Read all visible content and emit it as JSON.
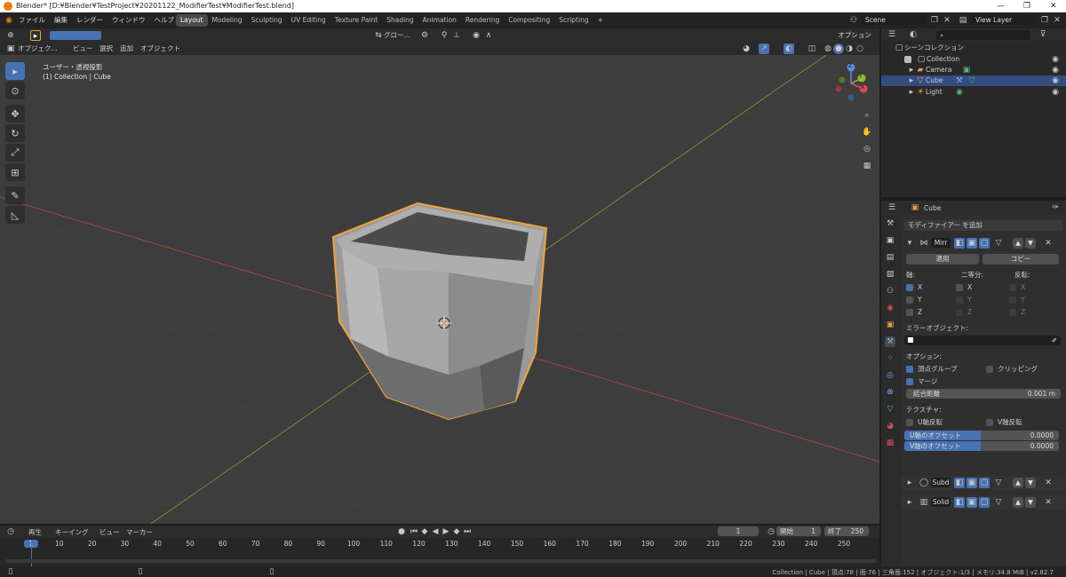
{
  "titlebar": {
    "title": "Blender* [D:¥Blender¥TestProject¥20201122_ModifierTest¥ModifierTest.blend]",
    "min": "—",
    "max": "❐",
    "close": "✕"
  },
  "menu": [
    "ファイル",
    "編集",
    "レンダー",
    "ウィンドウ",
    "ヘルプ"
  ],
  "workspaces": [
    "Layout",
    "Modeling",
    "Sculpting",
    "UV Editing",
    "Texture Paint",
    "Shading",
    "Animation",
    "Rendering",
    "Compositing",
    "Scripting",
    "+"
  ],
  "scene": {
    "label": "Scene",
    "view_layer": "View Layer"
  },
  "viewport": {
    "mode": "オブジェク...",
    "view": "ビュー",
    "select": "選択",
    "add": "追加",
    "object": "オブジェクト",
    "orientation": "グロー...",
    "options": "オプション",
    "info1": "ユーザー・透視投影",
    "info2": "(1) Collection | Cube",
    "axes": {
      "x": "X",
      "y": "Y",
      "z": "Z"
    }
  },
  "outliner": {
    "root": "シーンコレクション",
    "items": [
      "Collection",
      "Camera",
      "Cube",
      "Light"
    ]
  },
  "props": {
    "object": "Cube",
    "add_modifier": "モディファイアー を追加",
    "mod1": {
      "name": "Mirr",
      "apply": "適用",
      "copy": "コピー",
      "axis": "軸:",
      "bisect": "二等分:",
      "flip": "反転:",
      "x": "X",
      "y": "Y",
      "z": "Z",
      "mirror_obj": "ミラーオブジェクト:",
      "options": "オプション:",
      "vgroups": "頂点グループ",
      "clipping": "クリッピング",
      "merge": "マージ",
      "merge_dist": "結合距離",
      "merge_val": "0.001 m",
      "texture": "テクスチャ:",
      "flip_u": "U軸反転",
      "flip_v": "V軸反転",
      "u_off": "U軸のオフセット",
      "u_val": "0.0000",
      "v_off": "V軸のオフセット",
      "v_val": "0.0000"
    },
    "mod2": "Subd",
    "mod3": "Solid"
  },
  "timeline": {
    "play": "再生",
    "keying": "キーイング",
    "view": "ビュー",
    "marker": "マーカー",
    "current": "1",
    "start_label": "開始",
    "start": "1",
    "end_label": "終了",
    "end": "250",
    "ticks": [
      "1",
      "10",
      "20",
      "30",
      "40",
      "50",
      "60",
      "70",
      "80",
      "90",
      "100",
      "110",
      "120",
      "130",
      "140",
      "150",
      "160",
      "170",
      "180",
      "190",
      "200",
      "210",
      "220",
      "230",
      "240",
      "250"
    ]
  },
  "status": "Collection | Cube | 頂点:78 | 面:76 | 三角面:152 | オブジェクト:1/3 | メモリ:34.8 MiB | v2.82.7",
  "colors": {
    "accent": "#4772b3",
    "select_orange": "#f3a33c",
    "bg": "#3d3d3d"
  }
}
